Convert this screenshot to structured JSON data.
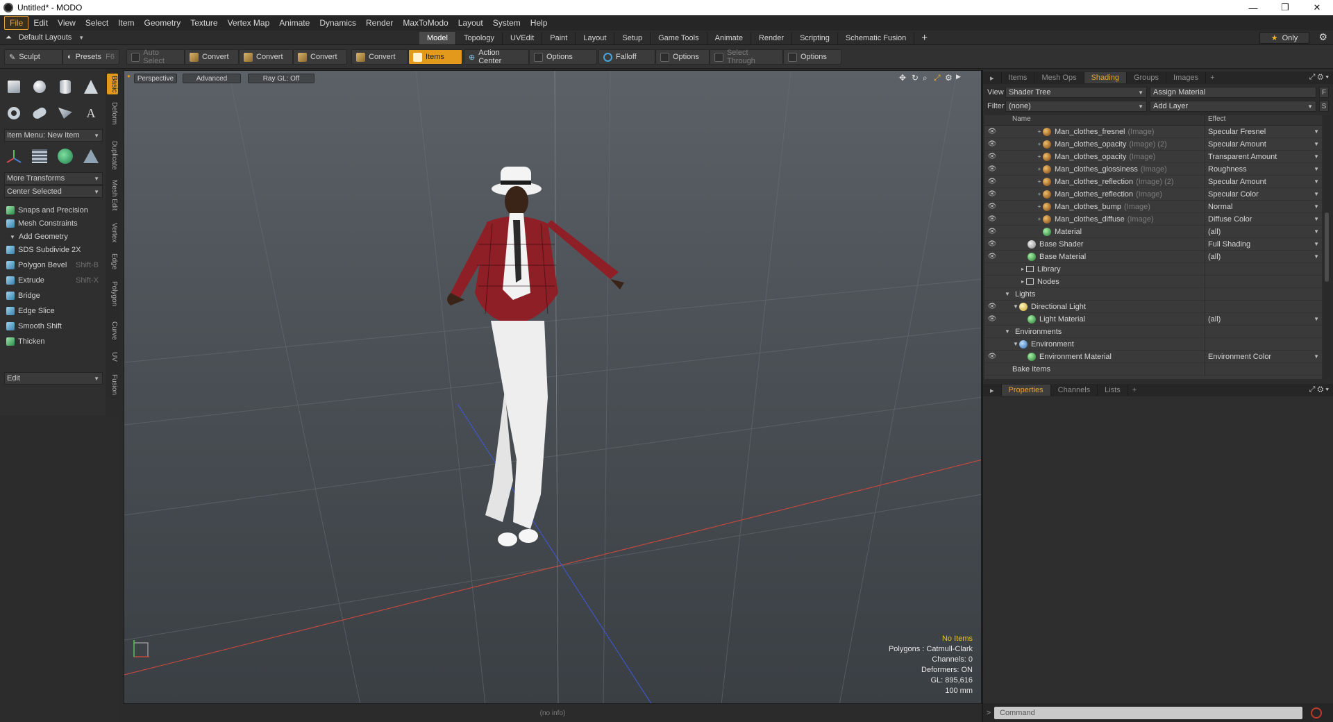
{
  "window": {
    "title": "Untitled* - MODO",
    "minimize": "—",
    "restore": "❐",
    "close": "✕"
  },
  "menu": [
    "File",
    "Edit",
    "View",
    "Select",
    "Item",
    "Geometry",
    "Texture",
    "Vertex Map",
    "Animate",
    "Dynamics",
    "Render",
    "MaxToModo",
    "Layout",
    "System",
    "Help"
  ],
  "layout_bar": {
    "layouts_label": "Default Layouts",
    "tabs": [
      "Model",
      "Topology",
      "UVEdit",
      "Paint",
      "Layout",
      "Setup",
      "Game Tools",
      "Animate",
      "Render",
      "Scripting",
      "Schematic Fusion"
    ],
    "active_tab": "Model",
    "only_label": "Only"
  },
  "toolbar": {
    "sculpt": "Sculpt",
    "presets": "Presets",
    "presets_shortcut": "F6",
    "auto_select": "Auto Select",
    "convert": "Convert",
    "items": "Items",
    "action_center": "Action Center",
    "options": "Options",
    "falloff": "Falloff",
    "select_through": "Select Through"
  },
  "left_panel": {
    "item_menu": "Item Menu: New Item",
    "more_transforms": "More Transforms",
    "center_selected": "Center Selected",
    "snaps": "Snaps and Precision",
    "mesh_constraints": "Mesh Constraints",
    "add_geometry": "Add Geometry",
    "tools": [
      {
        "label": "SDS Subdivide 2X",
        "shortcut": ""
      },
      {
        "label": "Polygon Bevel",
        "shortcut": "Shift-B"
      },
      {
        "label": "Extrude",
        "shortcut": "Shift-X"
      },
      {
        "label": "Bridge",
        "shortcut": ""
      },
      {
        "label": "Edge Slice",
        "shortcut": ""
      },
      {
        "label": "Smooth Shift",
        "shortcut": ""
      },
      {
        "label": "Thicken",
        "shortcut": ""
      }
    ],
    "edit_dropdown": "Edit",
    "side_tabs": [
      "Basic",
      "Deform",
      "Duplicate",
      "Mesh Edit",
      "Vertex",
      "Edge",
      "Polygon",
      "Curve",
      "UV",
      "Fusion"
    ]
  },
  "viewport": {
    "view_mode": "Perspective",
    "advanced": "Advanced",
    "raygl": "Ray GL: Off",
    "hud": {
      "selection": "No Items",
      "polygons": "Polygons : Catmull-Clark",
      "channels": "Channels: 0",
      "deformers": "Deformers: ON",
      "gl": "GL: 895,616",
      "scale": "100 mm"
    },
    "status": "(no info)"
  },
  "right_panel": {
    "tabs": [
      "Items",
      "Mesh Ops",
      "Shading",
      "Groups",
      "Images"
    ],
    "active_tab": "Shading",
    "view_label": "View",
    "view_value": "Shader Tree",
    "assign_material": "Assign Material",
    "filter_label": "Filter",
    "filter_value": "(none)",
    "add_layer": "Add Layer",
    "col_name": "Name",
    "col_effect": "Effect",
    "rows": [
      {
        "name": "Man_clothes_fresnel",
        "tag": "(Image)",
        "effect": "Specular Fresnel"
      },
      {
        "name": "Man_clothes_opacity",
        "tag": "(Image) (2)",
        "effect": "Specular Amount"
      },
      {
        "name": "Man_clothes_opacity",
        "tag": "(Image)",
        "effect": "Transparent Amount"
      },
      {
        "name": "Man_clothes_glossiness",
        "tag": "(Image)",
        "effect": "Roughness"
      },
      {
        "name": "Man_clothes_reflection",
        "tag": "(Image) (2)",
        "effect": "Specular Amount"
      },
      {
        "name": "Man_clothes_reflection",
        "tag": "(Image)",
        "effect": "Specular Color"
      },
      {
        "name": "Man_clothes_bump",
        "tag": "(Image)",
        "effect": "Normal"
      },
      {
        "name": "Man_clothes_diffuse",
        "tag": "(Image)",
        "effect": "Diffuse Color"
      },
      {
        "name": "Material",
        "tag": "",
        "effect": "(all)"
      },
      {
        "name": "Base Shader",
        "tag": "",
        "effect": "Full Shading"
      },
      {
        "name": "Base Material",
        "tag": "",
        "effect": "(all)"
      },
      {
        "name": "Library",
        "tag": "",
        "effect": ""
      },
      {
        "name": "Nodes",
        "tag": "",
        "effect": ""
      },
      {
        "name": "Lights",
        "tag": "",
        "effect": ""
      },
      {
        "name": "Directional Light",
        "tag": "",
        "effect": ""
      },
      {
        "name": "Light Material",
        "tag": "",
        "effect": "(all)"
      },
      {
        "name": "Environments",
        "tag": "",
        "effect": ""
      },
      {
        "name": "Environment",
        "tag": "",
        "effect": ""
      },
      {
        "name": "Environment Material",
        "tag": "",
        "effect": "Environment Color"
      },
      {
        "name": "Bake Items",
        "tag": "",
        "effect": ""
      }
    ],
    "bottom_tabs": [
      "Properties",
      "Channels",
      "Lists"
    ],
    "active_bottom_tab": "Properties",
    "command_placeholder": "Command"
  },
  "colors": {
    "accent": "#e39a1c",
    "background": "#2b2b2b"
  }
}
